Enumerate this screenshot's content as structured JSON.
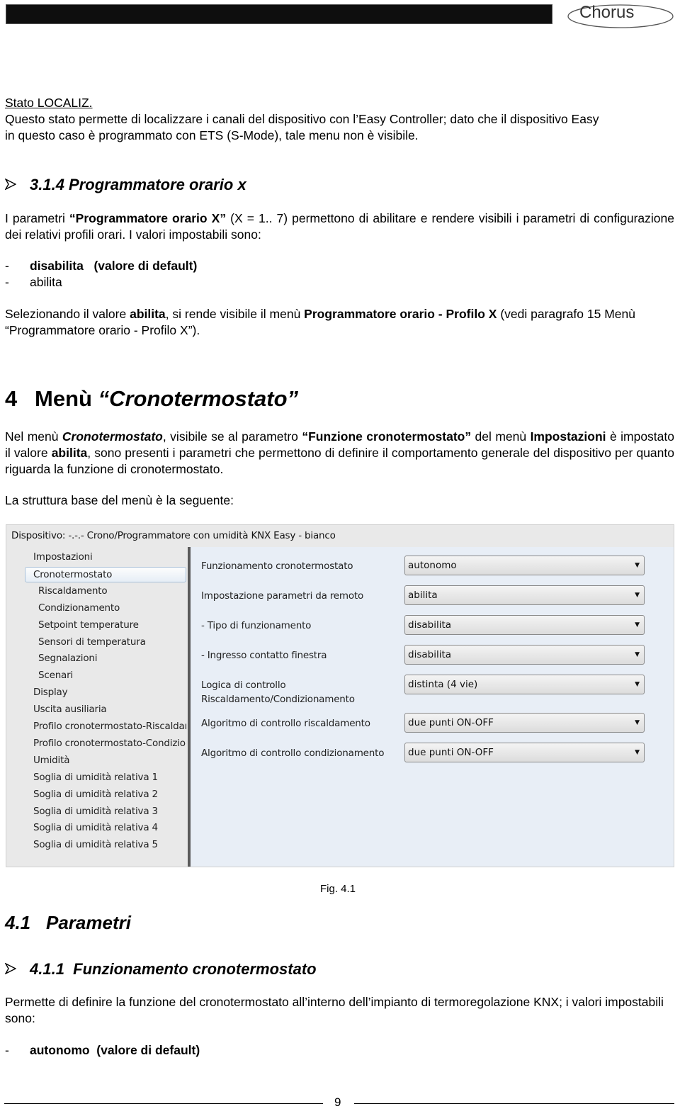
{
  "header": {
    "logo_text": "Chorus"
  },
  "section_localiz": {
    "title": "Stato LOCALIZ.",
    "line1": "Questo stato permette di localizzare i canali del dispositivo con l’Easy Controller; dato che il dispositivo Easy",
    "line2": "in questo caso è programmato con ETS (S-Mode), tale menu non è visibile."
  },
  "section_314": {
    "heading": "3.1.4 Programmatore orario x",
    "para1_pre": "I parametri ",
    "para1_bold": "“Programmatore orario X”",
    "para1_post": " (X = 1.. 7) permettono di abilitare e rendere visibili i parametri di configurazione dei relativi profili orari. I valori impostabili sono:",
    "options": [
      {
        "dash": "-",
        "label": "disabilita   (valore di default)",
        "bold": true
      },
      {
        "dash": "-",
        "label": "abilita",
        "bold": false
      }
    ],
    "para2_a": "Selezionando il valore ",
    "para2_b": "abilita",
    "para2_c": ", si rende visibile il menù ",
    "para2_d": "Programmatore orario - Profilo X",
    "para2_e": " (vedi paragrafo 15 Menù “Programmatore orario - Profilo X”)."
  },
  "section_4": {
    "number": "4",
    "title_pre": "Menù ",
    "title_italic": "“Cronotermostato”",
    "para_a": "Nel menù ",
    "para_b": "Cronotermostato",
    "para_c": ", visibile se al parametro ",
    "para_d": "“Funzione cronotermostato”",
    "para_e": " del menù ",
    "para_f": "Impostazioni",
    "para_g": " è impostato il valore ",
    "para_h": "abilita",
    "para_i": ", sono presenti i parametri che permettono di definire il comportamento generale del dispositivo per quanto riguarda la funzione di cronotermostato.",
    "structure_intro": "La struttura base del menù è la seguente:"
  },
  "ets_window": {
    "title": "Dispositivo: -.-.-  Crono/Programmatore con umidità KNX Easy - bianco",
    "tree": [
      {
        "label": "Impostazioni",
        "level": 0,
        "selected": false
      },
      {
        "label": "Cronotermostato",
        "level": 0,
        "selected": true
      },
      {
        "label": "Riscaldamento",
        "level": 1,
        "selected": false
      },
      {
        "label": "Condizionamento",
        "level": 1,
        "selected": false
      },
      {
        "label": "Setpoint temperature",
        "level": 1,
        "selected": false
      },
      {
        "label": "Sensori di temperatura",
        "level": 1,
        "selected": false
      },
      {
        "label": "Segnalazioni",
        "level": 1,
        "selected": false
      },
      {
        "label": "Scenari",
        "level": 1,
        "selected": false
      },
      {
        "label": "Display",
        "level": 0,
        "selected": false
      },
      {
        "label": "Uscita ausiliaria",
        "level": 0,
        "selected": false
      },
      {
        "label": "Profilo cronotermostato-Riscaldamento",
        "level": 0,
        "selected": false
      },
      {
        "label": "Profilo cronotermostato-Condizionamento",
        "level": 0,
        "selected": false
      },
      {
        "label": "Umidità",
        "level": 0,
        "selected": false
      },
      {
        "label": "Soglia di umidità relativa 1",
        "level": 0,
        "selected": false
      },
      {
        "label": "Soglia di umidità relativa 2",
        "level": 0,
        "selected": false
      },
      {
        "label": "Soglia di umidità relativa 3",
        "level": 0,
        "selected": false
      },
      {
        "label": "Soglia di umidità relativa 4",
        "level": 0,
        "selected": false
      },
      {
        "label": "Soglia di umidità relativa 5",
        "level": 0,
        "selected": false
      }
    ],
    "params": [
      {
        "label": "Funzionamento cronotermostato",
        "label2": "",
        "value": "autonomo"
      },
      {
        "label": "Impostazione parametri da remoto",
        "label2": "",
        "value": "abilita"
      },
      {
        "label": "- Tipo di funzionamento",
        "label2": "",
        "value": "disabilita"
      },
      {
        "label": "- Ingresso contatto finestra",
        "label2": "",
        "value": "disabilita"
      },
      {
        "label": "Logica di controllo",
        "label2": "Riscaldamento/Condizionamento",
        "value": "distinta (4 vie)"
      },
      {
        "label": "Algoritmo di controllo riscaldamento",
        "label2": "",
        "value": "due punti ON-OFF"
      },
      {
        "label": "Algoritmo di controllo condizionamento",
        "label2": "",
        "value": "due punti ON-OFF"
      }
    ],
    "dropdown_caret": "▼"
  },
  "figure_caption": "Fig. 4.1",
  "section_41": {
    "number": "4.1",
    "title": "Parametri"
  },
  "section_411": {
    "heading": "4.1.1  Funzionamento cronotermostato",
    "para": "Permette di definire la funzione del cronotermostato all’interno dell’impianto di termoregolazione KNX; i valori impostabili sono:",
    "options": [
      {
        "dash": "-",
        "label": "autonomo  (valore di default)",
        "bold": true
      }
    ]
  },
  "footer": {
    "page_number": "9"
  }
}
